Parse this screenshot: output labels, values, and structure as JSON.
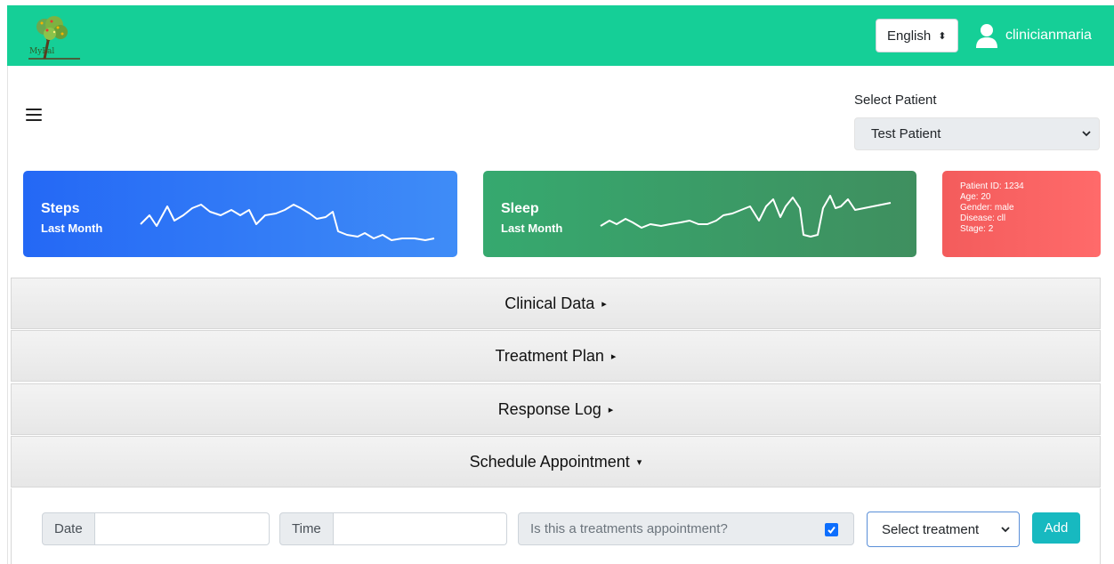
{
  "header": {
    "logo_text": "MyPal",
    "language": "English",
    "username": "clinicianmaria"
  },
  "patient_selector": {
    "label": "Select Patient",
    "selected": "Test Patient"
  },
  "cards": {
    "steps": {
      "title": "Steps",
      "subtitle": "Last Month"
    },
    "sleep": {
      "title": "Sleep",
      "subtitle": "Last Month"
    },
    "patient_info": {
      "id": "Patient ID: 1234",
      "age": "Age: 20",
      "gender": "Gender: male",
      "disease": "Disease: cll",
      "stage": "Stage: 2"
    }
  },
  "sections": {
    "clinical": "Clinical Data",
    "treatment": "Treatment Plan",
    "response": "Response Log",
    "schedule": "Schedule Appointment"
  },
  "appointment_form": {
    "date_label": "Date",
    "time_label": "Time",
    "treatment_question": "Is this a treatments appointment?",
    "treatment_checked": true,
    "treatment_select": "Select treatment",
    "add_label": "Add"
  },
  "colors": {
    "topbar": "#15cf97",
    "steps_card": "#2468f5",
    "sleep_card": "#36a96f",
    "info_card": "#f35c5c",
    "add_button": "#17b9c0"
  }
}
